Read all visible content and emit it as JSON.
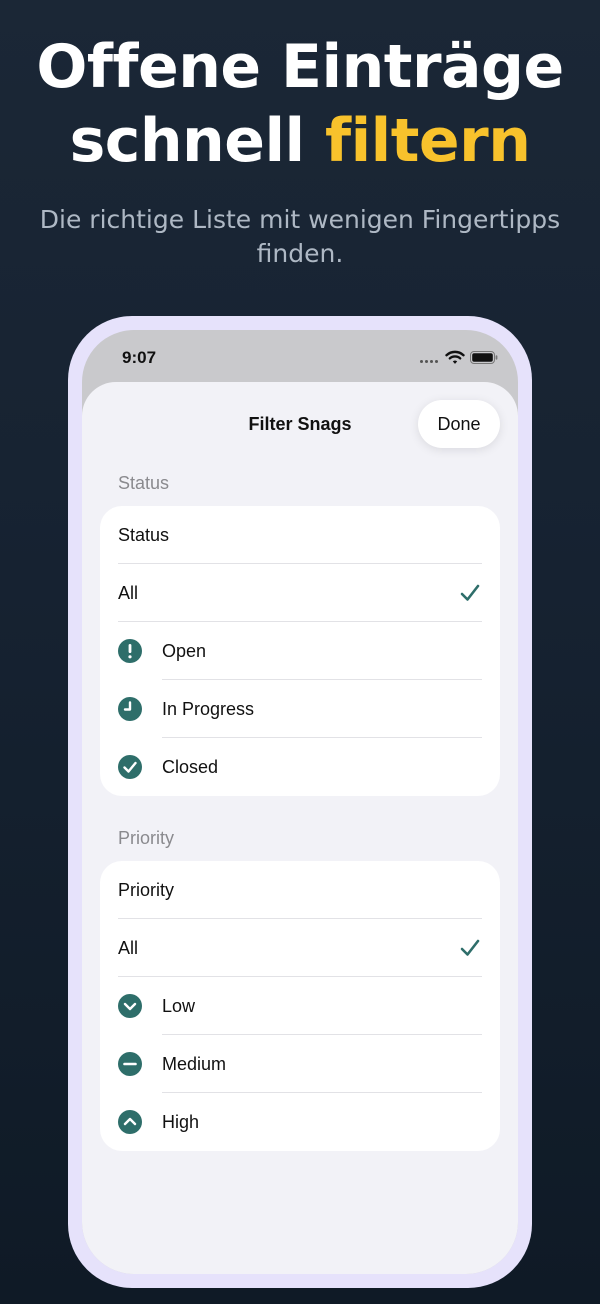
{
  "promo": {
    "headline_line1": "Offene Einträge",
    "headline_line2a": "schnell ",
    "headline_line2b": "filtern",
    "subtitle": "Die richtige Liste mit wenigen Fingertipps finden.",
    "accent_color": "#f8c22c"
  },
  "status_bar": {
    "time": "9:07",
    "icons": [
      "cellular-dots-icon",
      "wifi-icon",
      "battery-icon"
    ]
  },
  "sheet": {
    "title": "Filter Snags",
    "done_label": "Done"
  },
  "status_section": {
    "header": "Status",
    "picker_label": "Status",
    "options": [
      {
        "label": "All",
        "icon": null,
        "selected": true
      },
      {
        "label": "Open",
        "icon": "exclamation-circle-icon",
        "selected": false
      },
      {
        "label": "In Progress",
        "icon": "clock-circle-icon",
        "selected": false
      },
      {
        "label": "Closed",
        "icon": "checkmark-circle-icon",
        "selected": false
      }
    ]
  },
  "priority_section": {
    "header": "Priority",
    "picker_label": "Priority",
    "options": [
      {
        "label": "All",
        "icon": null,
        "selected": true
      },
      {
        "label": "Low",
        "icon": "chevron-down-circle-icon",
        "selected": false
      },
      {
        "label": "Medium",
        "icon": "minus-circle-icon",
        "selected": false
      },
      {
        "label": "High",
        "icon": "chevron-up-circle-icon",
        "selected": false
      }
    ]
  },
  "colors": {
    "icon_teal": "#2e6e6a",
    "sheet_bg": "#f2f2f7",
    "frame": "#e6e2fb"
  }
}
